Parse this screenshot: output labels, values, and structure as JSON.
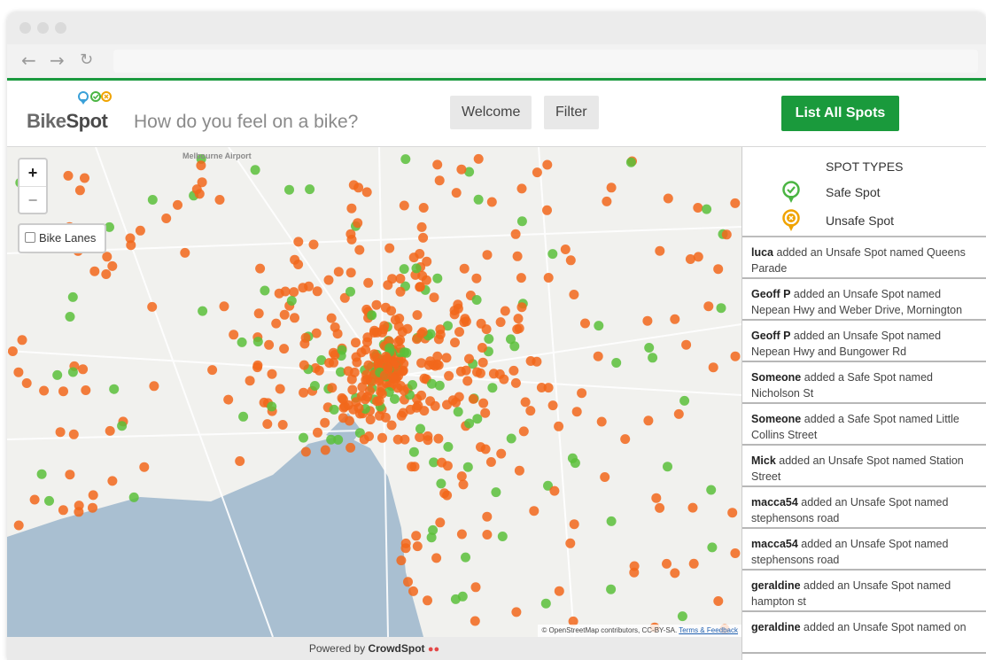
{
  "app": {
    "logo_bike": "Bike",
    "logo_spot": "Spot",
    "tagline": "How do you feel on a bike?"
  },
  "nav": {
    "back_icon": "arrow-left-icon",
    "forward_icon": "arrow-right-icon",
    "reload_icon": "reload-icon",
    "welcome_label": "Welcome",
    "filter_label": "Filter",
    "list_all_label": "List All Spots"
  },
  "map": {
    "zoom_in": "+",
    "zoom_out": "−",
    "bike_lanes_label": "Bike Lanes",
    "place_label": "Melbourne Airport",
    "attribution": "© OpenStreetMap contributors, CC-BY-SA.",
    "attribution_link": "Terms & Feedback",
    "safe_color": "#5ac03a",
    "unsafe_color": "#f2671b",
    "water_color": "#a9bfd1"
  },
  "footer": {
    "powered_by": "Powered by",
    "brand": "CrowdSpot"
  },
  "legend": {
    "title": "SPOT TYPES",
    "safe_label": "Safe Spot",
    "unsafe_label": "Unsafe Spot"
  },
  "feed": [
    {
      "user": "luca",
      "text": " added an Unsafe Spot named Queens Parade"
    },
    {
      "user": "Geoff P",
      "text": " added an Unsafe Spot named Nepean Hwy and Weber Drive, Mornington"
    },
    {
      "user": "Geoff P",
      "text": " added an Unsafe Spot named Nepean Hwy and Bungower Rd"
    },
    {
      "user": "Someone",
      "text": " added a Safe Spot named Nicholson St"
    },
    {
      "user": "Someone",
      "text": " added a Safe Spot named Little Collins Street"
    },
    {
      "user": "Mick",
      "text": " added an Unsafe Spot named Station Street"
    },
    {
      "user": "macca54",
      "text": " added an Unsafe Spot named stephensons road"
    },
    {
      "user": "macca54",
      "text": " added an Unsafe Spot named stephensons road"
    },
    {
      "user": "geraldine",
      "text": " added an Unsafe Spot named hampton st"
    },
    {
      "user": "geraldine",
      "text": " added an Unsafe Spot named on"
    }
  ]
}
